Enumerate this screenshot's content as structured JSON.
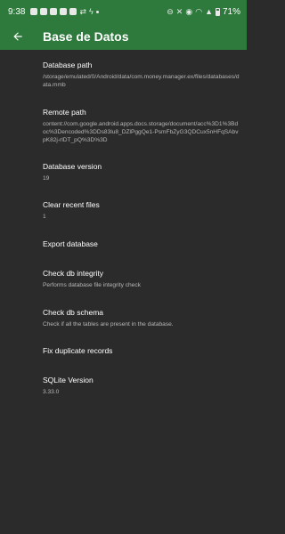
{
  "status_bar": {
    "time": "9:38",
    "battery": "71%",
    "icons": [
      "youtube-icon",
      "youtube-icon",
      "youtube-icon",
      "youtube-icon",
      "youtube-icon",
      "share-icon",
      "bolt-icon",
      "dot-icon"
    ],
    "right_icons": [
      "dnd-icon",
      "mute-icon",
      "hotspot-icon",
      "wifi-icon",
      "signal-icon",
      "battery-icon"
    ]
  },
  "appbar": {
    "title": "Base de Datos",
    "back_icon": "arrow-back-icon"
  },
  "colors": {
    "primary": "#2d7a3c",
    "background": "#2b2b2b",
    "text": "#ffffff",
    "secondary_text": "#b7b7b7"
  },
  "settings": [
    {
      "title": "Database path",
      "subtitle": "/storage/emulated/0/Android/data/com.money.manager.ex/files/databases/data.mmb"
    },
    {
      "title": "Remote path",
      "subtitle": "content://com.google.android.apps.docs.storage/document/acc%3D1%3Bdoc%3Dencoded%3DDs83lu8_DZlPggQe1-PsmFbZyG3QDCux5nHFqSAbvpK82j-rlDT_pQ%3D%3D"
    },
    {
      "title": "Database version",
      "subtitle": "19"
    },
    {
      "title": "Clear recent files",
      "subtitle": "1"
    },
    {
      "title": "Export database",
      "subtitle": ""
    },
    {
      "title": "Check db integrity",
      "subtitle": "Performs database file integrity check"
    },
    {
      "title": "Check db schema",
      "subtitle": "Check if all the tables are present in the database."
    },
    {
      "title": "Fix duplicate records",
      "subtitle": ""
    },
    {
      "title": "SQLite Version",
      "subtitle": "3.33.0"
    }
  ]
}
